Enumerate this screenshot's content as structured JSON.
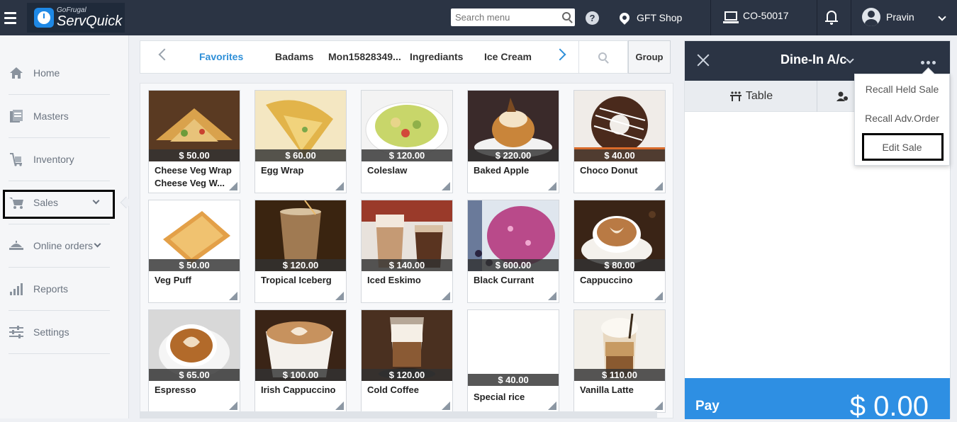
{
  "header": {
    "brand_small": "GoFrugal",
    "brand_name": "ServQuick",
    "search_placeholder": "Search menu",
    "shop": "GFT Shop",
    "counter": "CO-50017",
    "user": "Pravin",
    "icons": {
      "menu": "hamburger-icon",
      "help": "help-icon",
      "location": "location-pin-icon",
      "counter": "monitor-icon",
      "notifications": "bell-icon",
      "user": "avatar-icon"
    }
  },
  "sidebar": {
    "items": [
      {
        "label": "Home",
        "icon": "home-icon"
      },
      {
        "label": "Masters",
        "icon": "masters-icon"
      },
      {
        "label": "Inventory",
        "icon": "inventory-icon"
      },
      {
        "label": "Sales",
        "icon": "cart-icon",
        "expandable": true,
        "highlighted": true
      },
      {
        "label": "Online orders",
        "icon": "online-orders-icon",
        "expandable": true
      },
      {
        "label": "Reports",
        "icon": "reports-icon"
      },
      {
        "label": "Settings",
        "icon": "settings-icon"
      }
    ]
  },
  "categories": {
    "tabs": [
      "Favorites",
      "Badams",
      "Mon15828349...",
      "Ingrediants",
      "Ice Cream"
    ],
    "active": "Favorites",
    "group_label": "Group"
  },
  "products": [
    {
      "name": "Cheese Veg Wrap Cheese Veg W...",
      "price": "$ 50.00"
    },
    {
      "name": "Egg Wrap",
      "price": "$ 60.00"
    },
    {
      "name": "Coleslaw",
      "price": "$ 120.00"
    },
    {
      "name": "Baked Apple",
      "price": "$ 220.00"
    },
    {
      "name": "Choco Donut",
      "price": "$ 40.00"
    },
    {
      "name": "Veg Puff",
      "price": "$ 50.00"
    },
    {
      "name": "Tropical Iceberg",
      "price": "$ 120.00"
    },
    {
      "name": "Iced Eskimo",
      "price": "$ 140.00"
    },
    {
      "name": "Black Currant",
      "price": "$ 600.00"
    },
    {
      "name": "Cappuccino",
      "price": "$ 80.00"
    },
    {
      "name": "Espresso",
      "price": "$ 65.00"
    },
    {
      "name": "Irish Cappuccino",
      "price": "$ 100.00"
    },
    {
      "name": "Cold Coffee",
      "price": "$ 120.00"
    },
    {
      "name": "Special rice",
      "price": "$ 40.00"
    },
    {
      "name": "Vanilla Latte",
      "price": "$ 110.00"
    }
  ],
  "order_panel": {
    "title": "Dine-In A/c",
    "tabs": [
      {
        "label": "Table",
        "icon": "table-icon"
      },
      {
        "label": "",
        "icon": "customer-icon"
      }
    ],
    "pay_label": "Pay",
    "pay_amount": "$ 0.00"
  },
  "more_menu": {
    "items": [
      "Recall Held Sale",
      "Recall Adv.Order",
      "Edit Sale"
    ],
    "highlighted": "Edit Sale"
  },
  "colors": {
    "topbar": "#2b3444",
    "accent": "#2e8fd8",
    "pay": "#2e8fe3"
  }
}
